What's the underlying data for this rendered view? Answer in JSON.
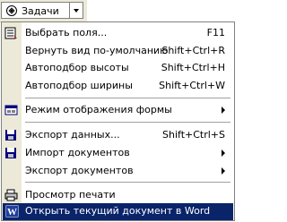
{
  "toolbar": {
    "button_label": "Задачи",
    "button_icon": "tasks-icon"
  },
  "menu": {
    "items": [
      {
        "label": "Выбрать поля...",
        "shortcut": "F11",
        "icon": "choose-fields-icon"
      },
      {
        "label": "Вернуть вид по-умолчанию",
        "shortcut": "Shift+Ctrl+R"
      },
      {
        "label": "Автоподбор высоты",
        "shortcut": "Shift+Ctrl+H"
      },
      {
        "label": "Автоподбор ширины",
        "shortcut": "Shift+Ctrl+W"
      },
      {
        "label": "Режим отображения формы",
        "icon": "form-view-icon",
        "submenu": true
      },
      {
        "label": "Экспорт данных...",
        "shortcut": "Shift+Ctrl+S",
        "icon": "export-data-icon"
      },
      {
        "label": "Импорт документов",
        "icon": "import-documents-icon",
        "submenu": true
      },
      {
        "label": "Экспорт документов",
        "submenu": true
      },
      {
        "label": "Просмотр печати",
        "icon": "print-preview-icon"
      },
      {
        "label": "Открыть текущий документ в Word",
        "icon": "word-icon",
        "highlighted": true
      }
    ]
  },
  "colors": {
    "highlight": "#0a246a",
    "gutter": "#ece9d8"
  }
}
